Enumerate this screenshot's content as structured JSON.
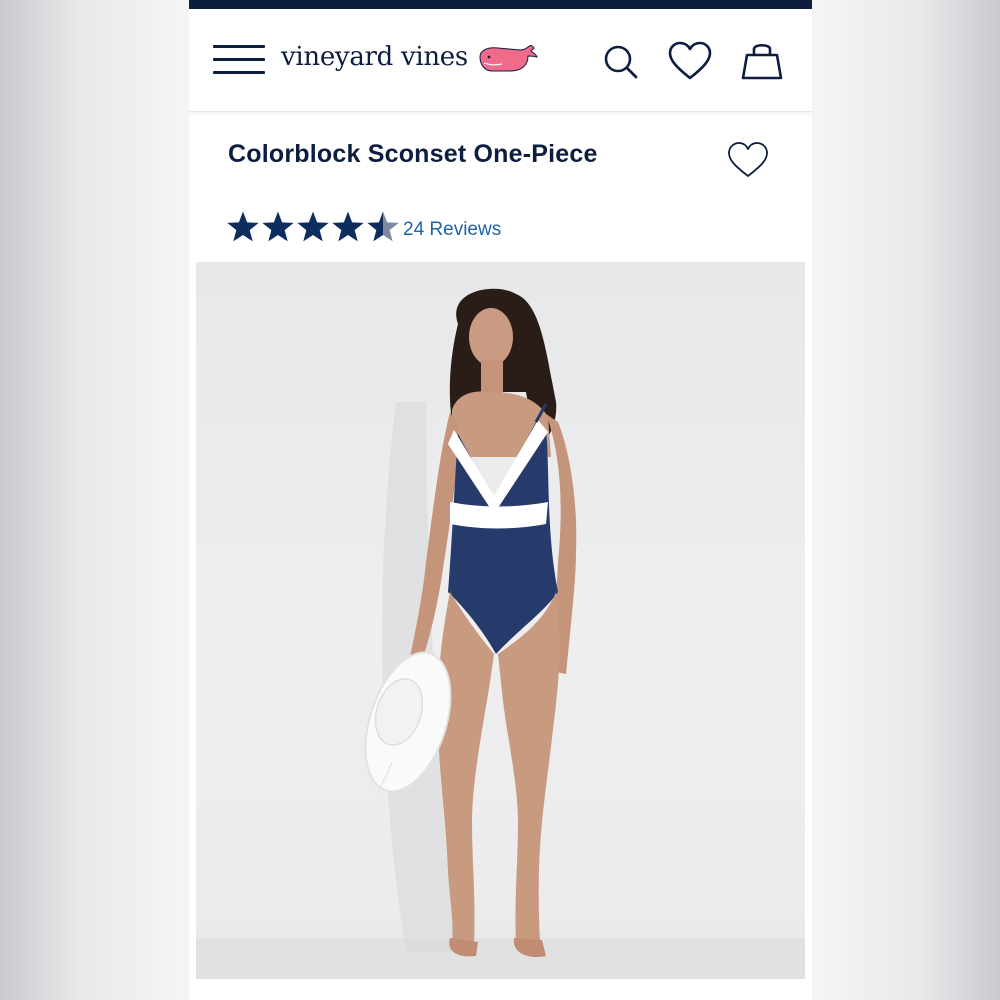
{
  "header": {
    "logo_text": "vineyard vines",
    "brand_color": "#0d1d3f",
    "whale_color": "#f06b8a",
    "icons": [
      "menu-icon",
      "search-icon",
      "heart-icon",
      "bag-icon"
    ]
  },
  "product": {
    "title": "Colorblock Sconset One-Piece",
    "rating": 4.5,
    "rating_max": 5,
    "reviews_label": "24 Reviews",
    "link_color": "#1f63a8",
    "image_alt": "Model wearing navy and white colorblock one-piece swimsuit holding a white sun hat"
  }
}
